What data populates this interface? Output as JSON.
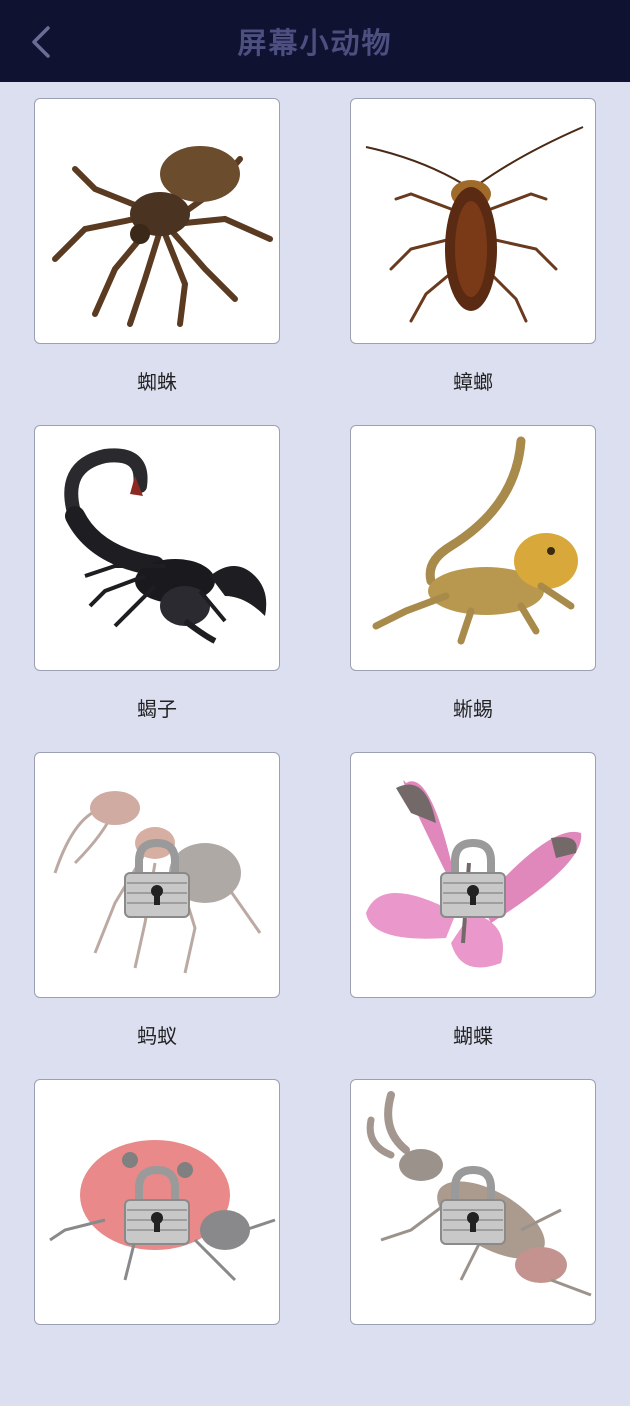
{
  "header": {
    "title": "屏幕小动物",
    "back_icon": "chevron-left-icon"
  },
  "animals": [
    {
      "name": "蜘蛛",
      "icon": "spider",
      "locked": false
    },
    {
      "name": "蟑螂",
      "icon": "cockroach",
      "locked": false
    },
    {
      "name": "蝎子",
      "icon": "scorpion",
      "locked": false
    },
    {
      "name": "蜥蜴",
      "icon": "lizard",
      "locked": false
    },
    {
      "name": "蚂蚁",
      "icon": "ant",
      "locked": true
    },
    {
      "name": "蝴蝶",
      "icon": "butterfly",
      "locked": true
    },
    {
      "name": "",
      "icon": "ladybug",
      "locked": true
    },
    {
      "name": "",
      "icon": "beetle",
      "locked": true
    }
  ],
  "colors": {
    "header_bg": "#0f1230",
    "page_bg": "#dcdff0",
    "title": "#4c4f7f"
  }
}
